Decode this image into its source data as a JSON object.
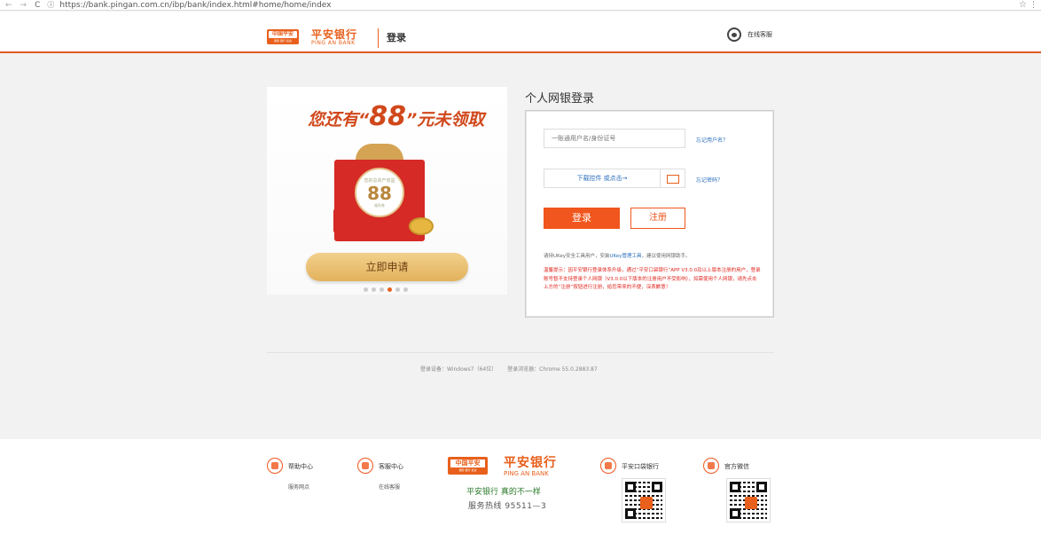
{
  "browser": {
    "url": "https://bank.pingan.com.cn/ibp/bank/index.html#home/home/index",
    "back": "←",
    "forward": "→",
    "reload": "C",
    "info": "ⓘ",
    "star": "☆",
    "menu": "⋮"
  },
  "header": {
    "logo_badge": "中国平安",
    "logo_badge_sub": "保险 银行 投资",
    "logo_cn": "平安银行",
    "logo_en": "PING AN BANK",
    "title": "登录",
    "service_label": "在线客服"
  },
  "banner": {
    "headline_pre": "您还有“",
    "headline_num": "88",
    "headline_post": "”元未领取",
    "gift_line1": "您的总资产收益",
    "gift_amount": "88",
    "gift_line3": "福利券",
    "button": "立即申请",
    "dots_count": 6,
    "active_dot": 3
  },
  "login": {
    "title": "个人网银登录",
    "username_placeholder": "一账通用户名/身份证号",
    "control_text": "下载控件 或点击→",
    "forgot_user": "忘记用户名？",
    "forgot_pwd": "忘记密码？",
    "login_button": "登录",
    "register_button": "注册",
    "tip_line": {
      "pre": "请持UKey安全工具用户，安装",
      "link": "UKey管理工具",
      "post": "，建议使用网银助手。"
    },
    "warning": "温馨提示：因平安银行登录体系升级，通过“平安口袋银行”APP V3.0.0及以上版本注册的用户，登录账号暂不支持登录个人网银（V3.0.0以下版本的注册用户不受影响），如需使用个人网银，请先点击上方的“注册”按钮进行注册，给您带来的不便，深表歉意！"
  },
  "sysinfo": {
    "os": "登录设备：Windows7（64位）",
    "browser": "登录浏览器：Chrome 55.0.2883.87"
  },
  "footer": {
    "help": {
      "title": "帮助中心",
      "sub": "服务网点"
    },
    "service": {
      "title": "客服中心",
      "sub": "在线客服"
    },
    "logo_badge": "中国平安",
    "logo_badge_sub": "保险 银行 投资",
    "logo_cn": "平安银行",
    "logo_en": "PING AN BANK",
    "slogan": "平安银行 真的不一样",
    "hotline": "服务热线 95511—3",
    "pocket": {
      "title": "平安口袋银行"
    },
    "wechat": {
      "title": "官方微信"
    }
  },
  "colors": {
    "brand_orange": "#e8601c",
    "link_blue": "#2a6ebb",
    "warning_red": "#e0261f"
  }
}
